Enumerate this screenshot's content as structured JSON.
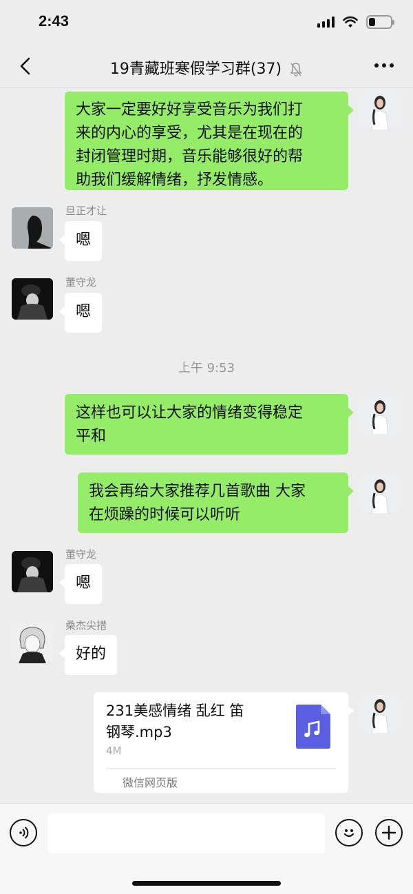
{
  "status_bar": {
    "time": "2:43",
    "battery_level": 0.3
  },
  "nav": {
    "title": "19青藏班寒假学习群(37)"
  },
  "messages": {
    "m1": {
      "text_line1": "大家一定要好好享受音乐为我们打",
      "text_line2": "来的内心的享受，尤其是在现在的",
      "text_line3": "封闭管理时期，音乐能够很好的帮",
      "text_line4": "助我们缓解情绪，抒发情感。"
    },
    "m2": {
      "sender": "旦正才让",
      "text": "嗯"
    },
    "m3": {
      "sender": "董守龙",
      "text": "嗯"
    },
    "timestamp": "上午 9:53",
    "m4": {
      "text_line1": "这样也可以让大家的情绪变得稳定",
      "text_line2": "平和"
    },
    "m5": {
      "text_line1": "我会再给大家推荐几首歌曲 大家",
      "text_line2": "在烦躁的时候可以听听"
    },
    "m6": {
      "sender": "董守龙",
      "text": "嗯"
    },
    "m7": {
      "sender": "桑杰尖措",
      "text": "好的"
    },
    "file": {
      "name_line1": "231美感情绪 乱红 笛",
      "name_line2": "钢琴.mp3",
      "size": "4M",
      "source": "微信网页版",
      "icon": "music-file-icon",
      "icon_color": "#5a5fe0"
    }
  },
  "input": {
    "placeholder": ""
  },
  "colors": {
    "bubble_green": "#95ec69",
    "background": "#ededed"
  }
}
